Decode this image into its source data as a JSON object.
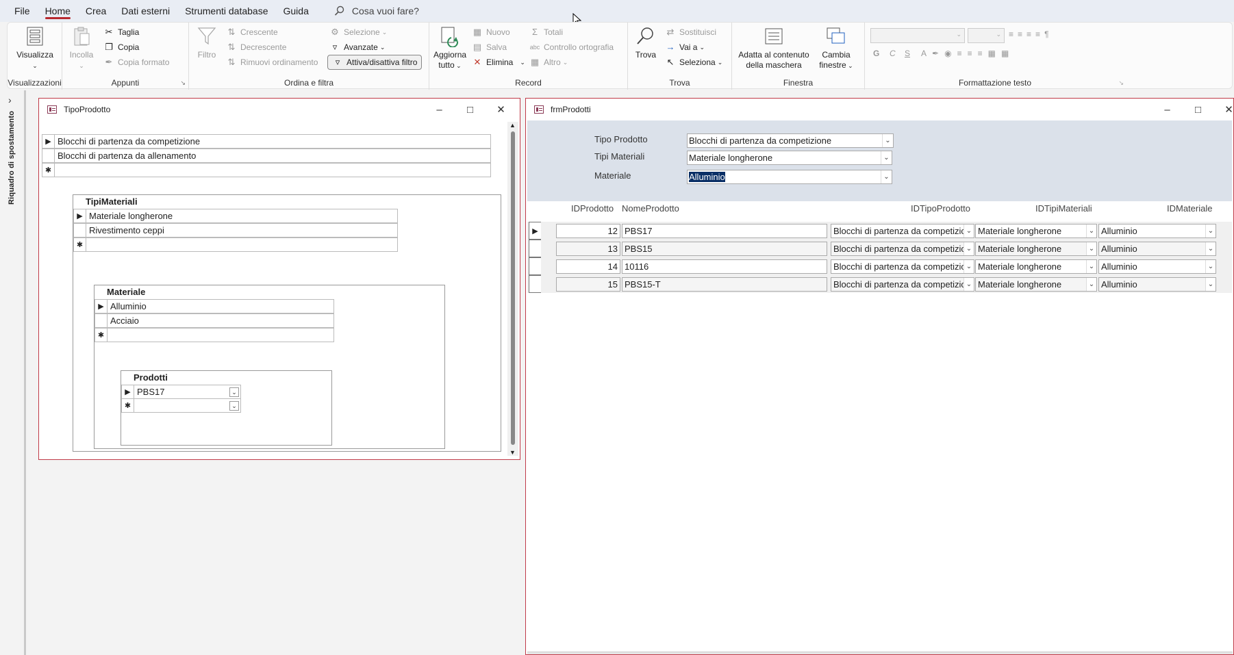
{
  "menu": {
    "items": [
      "File",
      "Home",
      "Crea",
      "Dati esterni",
      "Strumenti database",
      "Guida"
    ],
    "search": "Cosa vuoi fare?"
  },
  "ribbon": {
    "visualizzazioni": {
      "visualizza": "Visualizza",
      "label": "Visualizzazioni"
    },
    "appunti": {
      "incolla": "Incolla",
      "taglia": "Taglia",
      "copia": "Copia",
      "copia_formato": "Copia formato",
      "label": "Appunti"
    },
    "ordina": {
      "filtro": "Filtro",
      "crescente": "Crescente",
      "decrescente": "Decrescente",
      "rimuovi": "Rimuovi ordinamento",
      "selezione": "Selezione",
      "avanzate": "Avanzate",
      "attiva": "Attiva/disattiva filtro",
      "label": "Ordina e filtra"
    },
    "record": {
      "aggiorna1": "Aggiorna",
      "aggiorna2": "tutto",
      "nuovo": "Nuovo",
      "salva": "Salva",
      "elimina": "Elimina",
      "totali": "Totali",
      "controllo": "Controllo ortografia",
      "altro": "Altro",
      "label": "Record"
    },
    "trova": {
      "trova": "Trova",
      "sostituisci": "Sostituisci",
      "vai": "Vai a",
      "seleziona": "Seleziona",
      "label": "Trova"
    },
    "finestra": {
      "adatta1": "Adatta al contenuto",
      "adatta2": "della maschera",
      "cambia1": "Cambia",
      "cambia2": "finestre",
      "label": "Finestra"
    },
    "formattazione": {
      "label": "Formattazione testo",
      "bold": "G",
      "italic": "C",
      "underline": "S"
    }
  },
  "navpane": {
    "label": "Riquadro di spostamento"
  },
  "win_tipo": {
    "title": "TipoProdotto",
    "rows": [
      "Blocchi di partenza da competizione",
      "Blocchi di partenza da allenamento"
    ],
    "sub1": {
      "title": "TipiMateriali",
      "rows": [
        "Materiale longherone",
        "Rivestimento ceppi"
      ]
    },
    "sub2": {
      "title": "Materiale",
      "rows": [
        "Alluminio",
        "Acciaio"
      ]
    },
    "sub3": {
      "title": "Prodotti",
      "rows": [
        "PBS17"
      ]
    }
  },
  "win_frm": {
    "title": "frmProdotti",
    "labels": {
      "tipo": "Tipo Prodotto",
      "tipi": "Tipi Materiali",
      "mat": "Materiale"
    },
    "values": {
      "tipo": "Blocchi di partenza da competizione",
      "tipi": "Materiale longherone",
      "mat": "Alluminio"
    },
    "columns": [
      "IDProdotto",
      "NomeProdotto",
      "IDTipoProdotto",
      "IDTipiMateriali",
      "IDMateriale"
    ],
    "rows": [
      {
        "id": "12",
        "nome": "PBS17",
        "tipo": "Blocchi di partenza da competizione",
        "tipi": "Materiale longherone",
        "mat": "Alluminio"
      },
      {
        "id": "13",
        "nome": "PBS15",
        "tipo": "Blocchi di partenza da competizione",
        "tipi": "Materiale longherone",
        "mat": "Alluminio"
      },
      {
        "id": "14",
        "nome": "10116",
        "tipo": "Blocchi di partenza da competizione",
        "tipi": "Materiale longherone",
        "mat": "Alluminio"
      },
      {
        "id": "15",
        "nome": "PBS15-T",
        "tipo": "Blocchi di partenza da competizione",
        "tipi": "Materiale longherone",
        "mat": "Alluminio"
      }
    ]
  },
  "colors": {
    "accent": "#b7282e",
    "window_border": "#c03a48",
    "header_bg": "#dbe1ea"
  },
  "icons": {
    "search": "search-icon",
    "form": "form-icon"
  }
}
